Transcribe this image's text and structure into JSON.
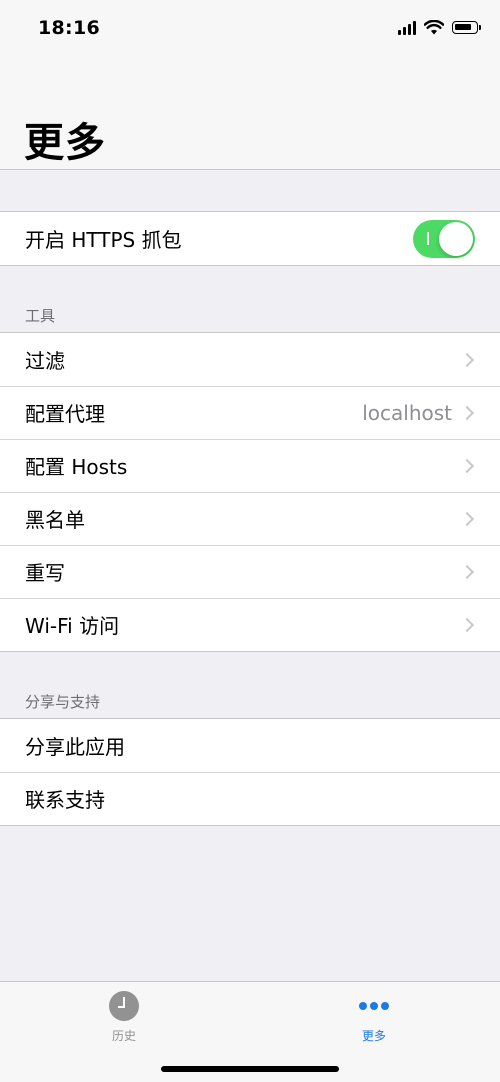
{
  "status_bar": {
    "time": "18:16"
  },
  "header": {
    "title": "更多"
  },
  "https_capture": {
    "label": "开启 HTTPS 抓包",
    "enabled": true
  },
  "tools_section": {
    "header": "工具",
    "items": [
      {
        "label": "过滤",
        "detail": ""
      },
      {
        "label": "配置代理",
        "detail": "localhost"
      },
      {
        "label": "配置 Hosts",
        "detail": ""
      },
      {
        "label": "黑名单",
        "detail": ""
      },
      {
        "label": "重写",
        "detail": ""
      },
      {
        "label": "Wi-Fi 访问",
        "detail": ""
      }
    ]
  },
  "share_section": {
    "header": "分享与支持",
    "items": [
      {
        "label": "分享此应用"
      },
      {
        "label": "联系支持"
      }
    ]
  },
  "tab_bar": {
    "tabs": [
      {
        "label": "历史",
        "icon": "clock-icon",
        "selected": false
      },
      {
        "label": "更多",
        "icon": "more-icon",
        "selected": true
      }
    ]
  },
  "colors": {
    "accent": "#1a7be6",
    "toggle_on": "#4cd964",
    "background": "#efeff4"
  }
}
